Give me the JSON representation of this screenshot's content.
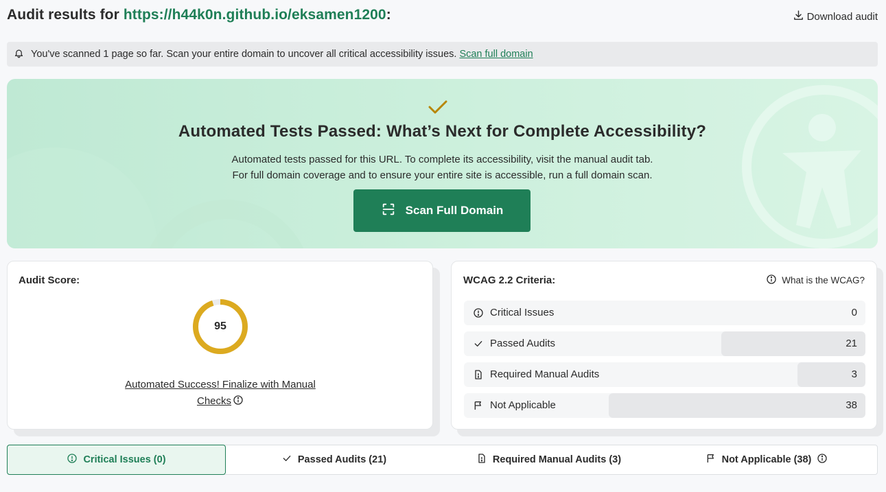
{
  "header": {
    "title_prefix": "Audit results for",
    "url": "https://h44k0n.github.io/eksamen1200",
    "title_suffix": ":",
    "download_label": "Download audit"
  },
  "notice": {
    "text": "You've scanned 1 page so far. Scan your entire domain to uncover all critical accessibility issues.",
    "link": "Scan full domain"
  },
  "hero": {
    "title": "Automated Tests Passed: What’s Next for Complete Accessibility?",
    "line1": "Automated tests passed for this URL. To complete its accessibility, visit the manual audit tab.",
    "line2": "For full domain coverage and to ensure your entire site is accessible, run a full domain scan.",
    "button_label": "Scan Full Domain"
  },
  "score_card": {
    "title": "Audit Score:",
    "score": "95",
    "score_fraction": 0.95,
    "link_line1": "Automated Success! Finalize with Manual",
    "link_line2": "Checks"
  },
  "wcag_card": {
    "title": "WCAG 2.2 Criteria:",
    "help_label": "What is the WCAG?",
    "rows": [
      {
        "label": "Critical Issues",
        "count": "0",
        "icon": "alert-circle-icon"
      },
      {
        "label": "Passed Audits",
        "count": "21",
        "icon": "check-icon"
      },
      {
        "label": "Required Manual Audits",
        "count": "3",
        "icon": "manual-doc-icon"
      },
      {
        "label": "Not Applicable",
        "count": "38",
        "icon": "flag-icon"
      }
    ]
  },
  "tabs": [
    {
      "label": "Critical Issues (0)",
      "icon": "alert-circle-icon",
      "active": true
    },
    {
      "label": "Passed Audits (21)",
      "icon": "check-icon"
    },
    {
      "label": "Required Manual Audits (3)",
      "icon": "manual-doc-icon"
    },
    {
      "label": "Not Applicable (38)",
      "icon": "flag-icon"
    }
  ],
  "colors": {
    "brand_green": "#1f7f57",
    "score_ring": "#dcaa20",
    "check_gold": "#b8860b"
  }
}
